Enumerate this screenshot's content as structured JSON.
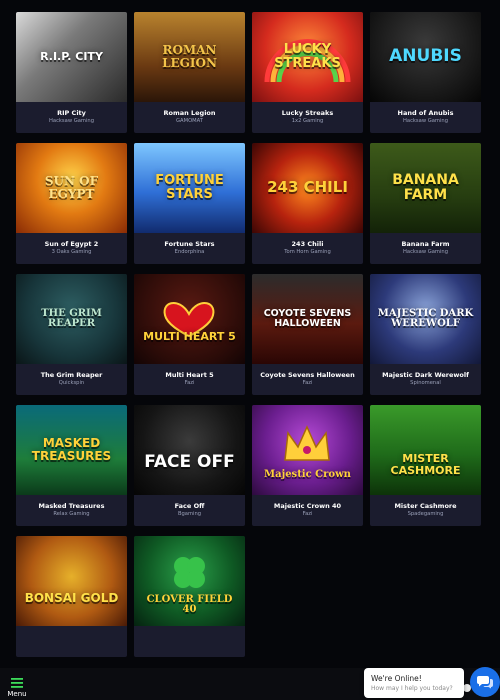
{
  "games": [
    {
      "name": "RIP City",
      "provider": "Hacksaw Gaming",
      "art": "R.I.P. CITY",
      "color": "#ffffff"
    },
    {
      "name": "Roman Legion",
      "provider": "GAMOMAT",
      "art": "ROMAN LEGION",
      "color": "#f3c44a"
    },
    {
      "name": "Lucky Streaks",
      "provider": "1x2 Gaming",
      "art": "LUCKY STREAKS",
      "color": "#ffe14a"
    },
    {
      "name": "Hand of Anubis",
      "provider": "Hacksaw Gaming",
      "art": "ANUBIS",
      "color": "#4fd9ff"
    },
    {
      "name": "Sun of Egypt 2",
      "provider": "3 Oaks Gaming",
      "art": "SUN OF EGYPT",
      "color": "#ffe28a"
    },
    {
      "name": "Fortune Stars",
      "provider": "Endorphina",
      "art": "FORTUNE STARS",
      "color": "#ffd23a"
    },
    {
      "name": "243 Chili",
      "provider": "Tom Horn Gaming",
      "art": "243 CHILI",
      "color": "#ffd23a"
    },
    {
      "name": "Banana Farm",
      "provider": "Hacksaw Gaming",
      "art": "BANANA FARM",
      "color": "#ffe14a"
    },
    {
      "name": "The Grim Reaper",
      "provider": "Quickspin",
      "art": "THE GRIM REAPER",
      "color": "#bfe8d0"
    },
    {
      "name": "Multi Heart 5",
      "provider": "Fazi",
      "art": "MULTI HEART 5",
      "color": "#ffd23a"
    },
    {
      "name": "Coyote Sevens Halloween",
      "provider": "Fazi",
      "art": "COYOTE SEVENS HALLOWEEN",
      "color": "#ffffff"
    },
    {
      "name": "Majestic Dark Werewolf",
      "provider": "Spinomenal",
      "art": "MAJESTIC DARK WEREWOLF",
      "color": "#ffffff"
    },
    {
      "name": "Masked Treasures",
      "provider": "Relax Gaming",
      "art": "MASKED TREASURES",
      "color": "#ffd23a"
    },
    {
      "name": "Face Off",
      "provider": "Bgaming",
      "art": "FACE OFF",
      "color": "#ffffff"
    },
    {
      "name": "Majestic Crown 40",
      "provider": "Fazi",
      "art": "Majestic Crown",
      "color": "#ffd23a"
    },
    {
      "name": "Mister Cashmore",
      "provider": "Spadegaming",
      "art": "MISTER CASHMORE",
      "color": "#ffe14a"
    },
    {
      "name": "",
      "provider": "",
      "art": "BONSAI GOLD",
      "color": "#ffe14a"
    },
    {
      "name": "",
      "provider": "",
      "art": "CLOVER FIELD 40",
      "color": "#ffd23a"
    }
  ],
  "bottom_bar": {
    "menu_label": "Menu"
  },
  "chat": {
    "title": "We're Online!",
    "subtitle": "How may I help you today?"
  },
  "colors": {
    "page_bg": "#05060a",
    "card_bg": "#1b1c2e",
    "provider_text": "#9aa0b8",
    "chat_accent": "#1a6fe8",
    "menu_icon": "#3ddc5a"
  }
}
